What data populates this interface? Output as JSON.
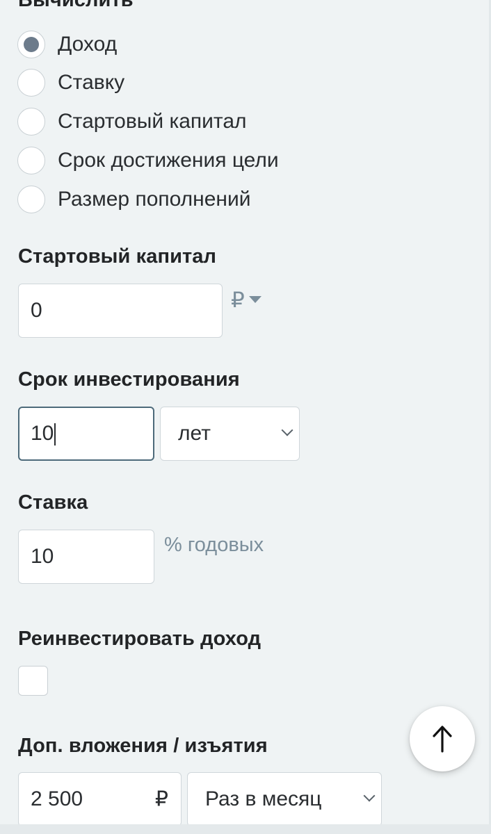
{
  "calc_section": {
    "title": "Вычислить",
    "options": [
      {
        "label": "Доход",
        "selected": true
      },
      {
        "label": "Ставку",
        "selected": false
      },
      {
        "label": "Стартовый капитал",
        "selected": false
      },
      {
        "label": "Срок достижения цели",
        "selected": false
      },
      {
        "label": "Размер пополнений",
        "selected": false
      }
    ]
  },
  "start_capital": {
    "title": "Стартовый капитал",
    "value": "0",
    "currency": "₽"
  },
  "term": {
    "title": "Срок инвестирования",
    "value": "10",
    "unit": "лет"
  },
  "rate": {
    "title": "Ставка",
    "value": "10",
    "suffix": "% годовых"
  },
  "reinvest": {
    "title": "Реинвестировать доход",
    "checked": false
  },
  "contributions": {
    "title": "Доп. вложения / изъятия",
    "value": "2 500",
    "currency": "₽",
    "frequency": "Раз в месяц"
  },
  "colors": {
    "background": "#eff3f4",
    "radio_selected": "#6c7b8b",
    "suffix_text": "#7b8e9b",
    "focus_border": "#4d6a7a"
  },
  "icons": {
    "scroll_top": "arrow-up-icon",
    "dropdown": "chevron-down-icon",
    "currency_dropdown": "triangle-down-icon"
  }
}
